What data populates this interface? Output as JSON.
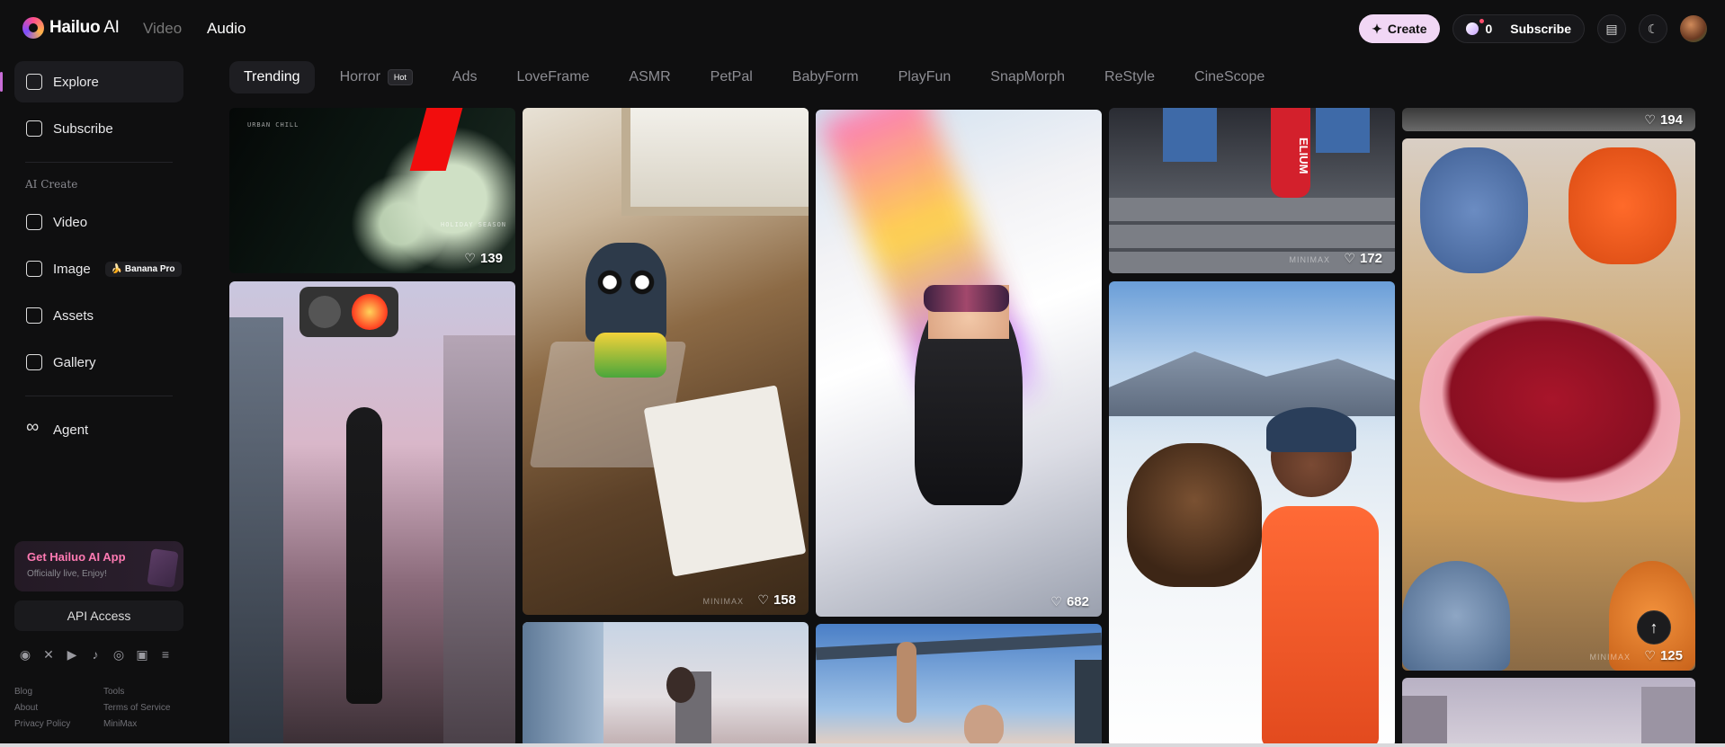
{
  "brand": {
    "name": "Hailuo",
    "suffix": " AI"
  },
  "mode_tabs": [
    {
      "label": "Video"
    },
    {
      "label": "Audio"
    }
  ],
  "top": {
    "create_label": "Create",
    "credits": "0",
    "subscribe_label": "Subscribe"
  },
  "sidebar": {
    "explore": "Explore",
    "subscribe": "Subscribe",
    "section_label": "AI Create",
    "video": "Video",
    "image": "Image",
    "image_badge": "🍌 Banana Pro",
    "assets": "Assets",
    "gallery": "Gallery",
    "agent": "Agent",
    "app_title": "Get Hailuo AI App",
    "app_sub": "Officially live, Enjoy!",
    "api_label": "API Access",
    "footer": [
      "Blog",
      "Tools",
      "About",
      "Terms of Service",
      "Privacy Policy",
      "MiniMax"
    ]
  },
  "category_tabs": [
    {
      "label": "Trending"
    },
    {
      "label": "Horror",
      "badge": "Hot"
    },
    {
      "label": "Ads"
    },
    {
      "label": "LoveFrame"
    },
    {
      "label": "ASMR"
    },
    {
      "label": "PetPal"
    },
    {
      "label": "BabyForm"
    },
    {
      "label": "PlayFun"
    },
    {
      "label": "SnapMorph"
    },
    {
      "label": "ReStyle"
    },
    {
      "label": "CineScope"
    }
  ],
  "cards": {
    "flowers": {
      "likes": "139",
      "caption_top": "URBAN CHILL",
      "caption_bottom": "HOLIDAY SEASON"
    },
    "crafts": {
      "likes": "158",
      "watermark": "MINIMAX"
    },
    "skier": {
      "likes": "682"
    },
    "stairs": {
      "likes": "172",
      "watermark": "MINIMAX",
      "sign_text": "ELIUM"
    },
    "topright": {
      "likes": "194"
    },
    "felt": {
      "likes": "125",
      "watermark": "MINIMAX"
    },
    "bear": {},
    "traffic": {},
    "city": {},
    "bar": {},
    "bottomright": {}
  },
  "colors": {
    "accent": "#c86dd7",
    "create_bg": "#f1d7f5",
    "app_title": "#ff7ab3"
  }
}
